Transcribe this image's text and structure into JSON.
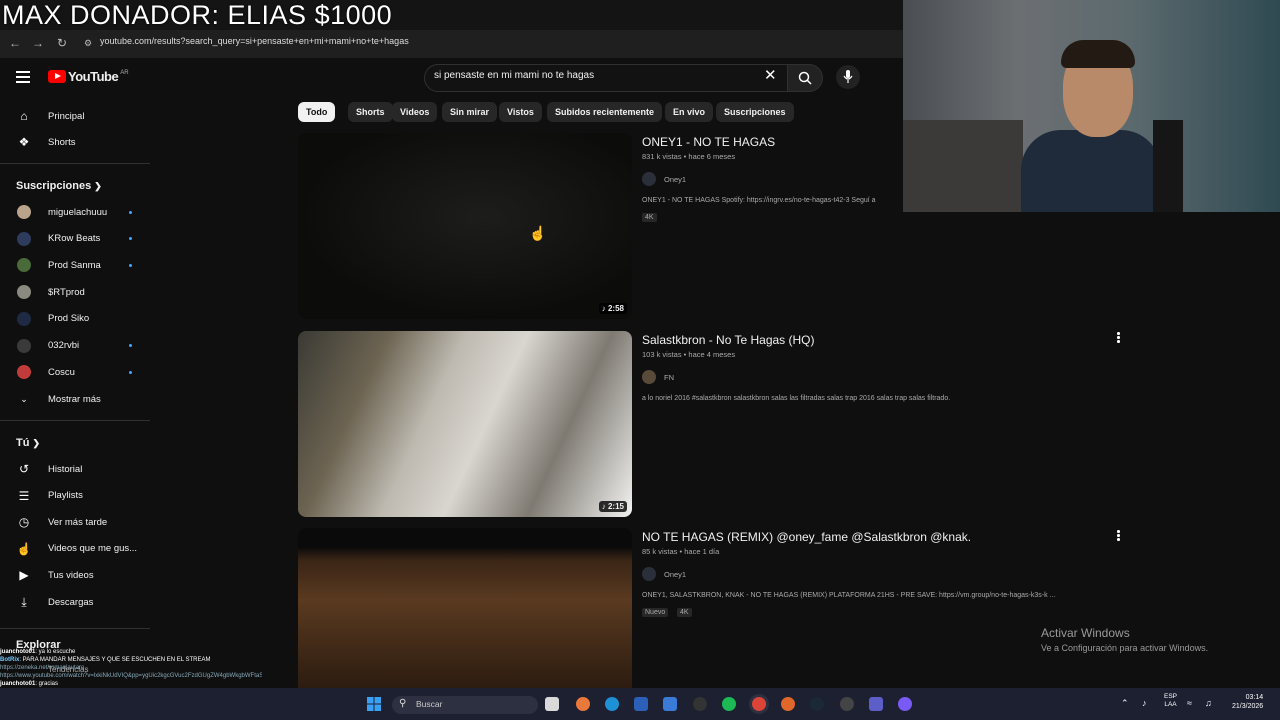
{
  "overlay": {
    "stream_title": "MAX DONADOR: ELIAS $1000",
    "chat": [
      {
        "user": "juanchoto01",
        "text": ": ya lo escuche"
      },
      {
        "user": "BotRix",
        "text": ": PARA MANDAR MENSAJES Y QUE SE ESCUCHEN EN EL STREAM"
      },
      {
        "user": "",
        "text": "https://zeneka.net/romanlautaro"
      },
      {
        "user": "",
        "text": "https://www.youtube.com/watch?v=lxkiNkUdVIQ&pp=ygUic2kgcGVuc2FzdGUgZW4gbWkgbWFtaSBub3BzOW4..."
      },
      {
        "user": "juanchoto01",
        "text": ": gracias"
      }
    ]
  },
  "browser": {
    "url": "youtube.com/results?search_query=si+pensaste+en+mi+mami+no+te+hagas"
  },
  "header": {
    "logo_text": "YouTube",
    "country_code": "AR",
    "search_value": "si pensaste en mi mami no te hagas"
  },
  "chips": [
    "Todo",
    "Shorts",
    "Videos",
    "Sin mirar",
    "Vistos",
    "Subidos recientemente",
    "En vivo",
    "Suscripciones"
  ],
  "sidebar": {
    "main": [
      {
        "label": "Principal",
        "icon": "home-icon"
      },
      {
        "label": "Shorts",
        "icon": "shorts-icon"
      }
    ],
    "subscriptions_title": "Suscripciones",
    "subscriptions": [
      {
        "label": "miguelachuuu",
        "color": "#b9a38a",
        "live": true
      },
      {
        "label": "KRow Beats",
        "color": "#2d3c5c",
        "live": true
      },
      {
        "label": "Prod Sanma",
        "color": "#4a6a3a",
        "live": true
      },
      {
        "label": "$RTprod",
        "color": "#8a8a80",
        "live": false
      },
      {
        "label": "Prod Siko",
        "color": "#1e2a44",
        "live": false
      },
      {
        "label": "032rvbi",
        "color": "#3a3a3a",
        "live": true
      },
      {
        "label": "Coscu",
        "color": "#c23b3b",
        "live": true
      }
    ],
    "show_more": "Mostrar más",
    "you_title": "Tú",
    "you": [
      {
        "label": "Historial",
        "icon": "history-icon"
      },
      {
        "label": "Playlists",
        "icon": "playlist-icon"
      },
      {
        "label": "Ver más tarde",
        "icon": "clock-icon"
      },
      {
        "label": "Videos que me gus...",
        "icon": "like-icon"
      },
      {
        "label": "Tus videos",
        "icon": "video-icon"
      },
      {
        "label": "Descargas",
        "icon": "download-icon"
      }
    ],
    "explore_title": "Explorar",
    "explore_first": "Tendencias"
  },
  "results": [
    {
      "title": "ONEY1 - NO TE HAGAS",
      "meta": "831 k vistas • hace 6 meses",
      "channel": "Oney1",
      "description": "ONEY1 - NO TE HAGAS Spotify: https://ingrv.es/no-te-hagas-t42-3 Seguí a",
      "badges": [
        "4K"
      ],
      "duration": "2:58"
    },
    {
      "title": "Salastkbron - No Te Hagas (HQ)",
      "meta": "103 k vistas • hace 4 meses",
      "channel": "FN",
      "description": "a lo noriel 2016 #salastkbron salastkbron salas las filtradas salas trap 2016 salas trap salas filtrado.",
      "badges": [],
      "duration": "2:15"
    },
    {
      "title": "NO TE HAGAS (REMIX) @oney_fame @Salastkbron @knak.",
      "meta": "85 k vistas • hace 1 día",
      "channel": "Oney1",
      "description": "ONEY1, SALASTKBRON, KNAK - NO TE HAGAS (REMIX) PLATAFORMA 21HS - PRE SAVE: https://vm.group/no-te-hagas-k3s-k ...",
      "badges": [
        "Nuevo",
        "4K"
      ],
      "duration": ""
    }
  ],
  "windows": {
    "activate_title": "Activar Windows",
    "activate_sub": "Ve a Configuración para activar Windows.",
    "search_placeholder": "Buscar",
    "lang": "ESP",
    "lang2": "LAA",
    "time": "03:14",
    "date": "21/3/2026"
  }
}
